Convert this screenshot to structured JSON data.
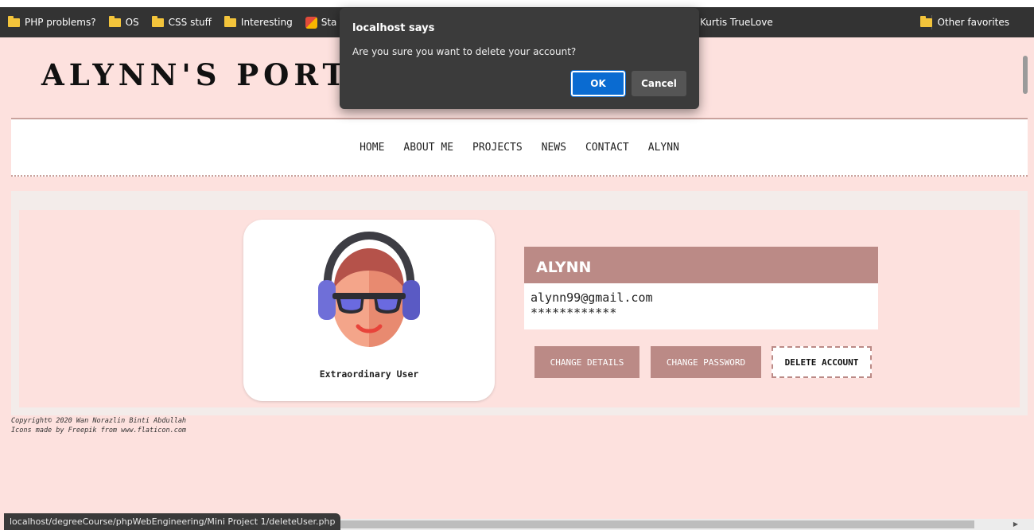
{
  "bookmarks": {
    "items": [
      {
        "label": "PHP problems?",
        "icon": "folder-icon"
      },
      {
        "label": "OS",
        "icon": "folder-icon"
      },
      {
        "label": "CSS stuff",
        "icon": "folder-icon"
      },
      {
        "label": "Interesting",
        "icon": "folder-icon"
      },
      {
        "label": "Sta",
        "icon": "site-icon"
      }
    ],
    "partial_item": "Kurtis TrueLove",
    "other_favorites": "Other favorites"
  },
  "site": {
    "title": "ALYNN'S PORTFOLIO"
  },
  "nav": {
    "items": [
      "HOME",
      "ABOUT ME",
      "PROJECTS",
      "NEWS",
      "CONTACT",
      "ALYNN"
    ]
  },
  "profile": {
    "role": "Extraordinary User",
    "name": "ALYNN",
    "email": "alynn99@gmail.com",
    "password_mask": "************"
  },
  "actions": {
    "change_details": "CHANGE DETAILS",
    "change_password": "CHANGE PASSWORD",
    "delete_account": "DELETE ACCOUNT"
  },
  "footer": {
    "copyright": "Copyright© 2020 Wan Norazlin Binti Abdullah",
    "credits": "Icons made by Freepik from www.flaticon.com"
  },
  "status_bar": {
    "url": "localhost/degreeCourse/phpWebEngineering/Mini Project 1/deleteUser.php"
  },
  "dialog": {
    "title": "localhost says",
    "message": "Are you sure you want to delete your account?",
    "ok_label": "OK",
    "cancel_label": "Cancel"
  },
  "colors": {
    "page_bg": "#fde1de",
    "accent": "#bb8a86",
    "dialog_bg": "#3b3b3b",
    "ok_blue": "#0a6bd1"
  }
}
